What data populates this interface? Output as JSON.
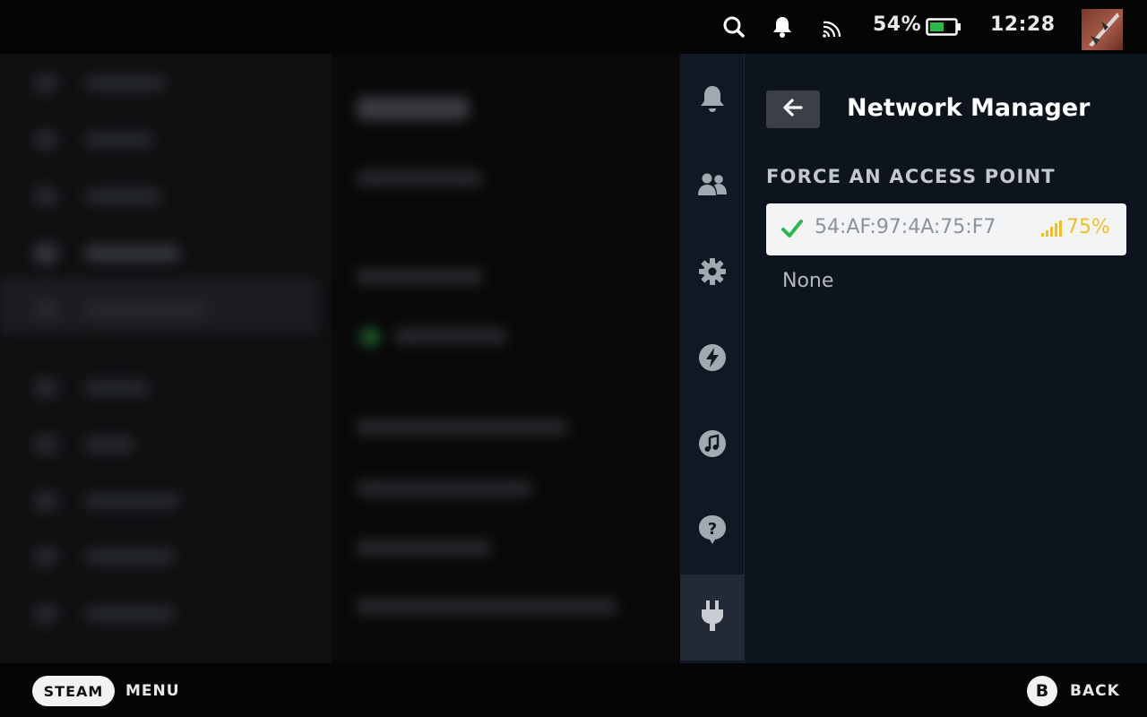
{
  "status_bar": {
    "battery_percent": "54%",
    "battery_level": 0.54,
    "clock": "12:28",
    "icons": [
      "search-icon",
      "notification-bell-icon",
      "wifi-icon",
      "battery-icon"
    ]
  },
  "sidebar": {
    "items": [
      {
        "icon": "bell-icon"
      },
      {
        "icon": "friends-icon"
      },
      {
        "icon": "gear-icon"
      },
      {
        "icon": "lightning-icon"
      },
      {
        "icon": "music-icon"
      },
      {
        "icon": "help-icon"
      },
      {
        "icon": "plug-icon",
        "active": true
      }
    ]
  },
  "panel": {
    "title": "Network Manager",
    "section_label": "FORCE AN ACCESS POINT",
    "access_points": [
      {
        "name": "54:AF:97:4A:75:F7",
        "signal": "75%",
        "selected": true
      }
    ],
    "none_option": "None"
  },
  "bottom_bar": {
    "steam_label": "STEAM",
    "menu_label": "MENU",
    "b_button": "B",
    "back_label": "BACK"
  },
  "colors": {
    "accent_green": "#2bb84a",
    "signal_yellow": "#f0c020",
    "panel_bg": "#0e141d",
    "rail_bg": "#111824"
  }
}
